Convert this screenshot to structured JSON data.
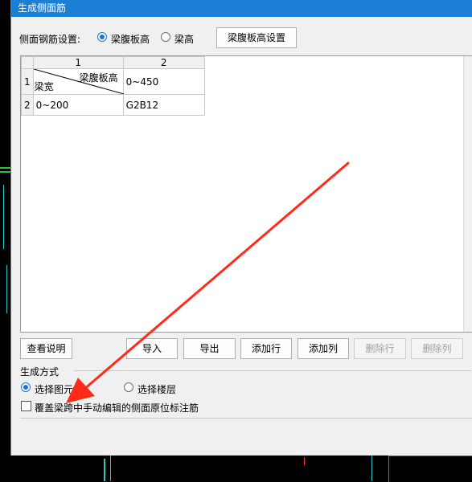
{
  "dialog": {
    "title": "生成侧面筋"
  },
  "settings": {
    "label": "侧面钢筋设置:",
    "options": [
      {
        "label": "梁腹板高",
        "checked": true
      },
      {
        "label": "梁高",
        "checked": false
      }
    ],
    "config_button": "梁腹板高设置"
  },
  "table": {
    "column_headers": [
      "1",
      "2"
    ],
    "row_headers": [
      "1",
      "2"
    ],
    "corner_top": "梁腹板高",
    "corner_bottom": "梁宽",
    "rows": [
      [
        "0~450"
      ],
      [
        "0~200",
        "G2B12"
      ]
    ]
  },
  "buttons": {
    "help": "查看说明",
    "import": "导入",
    "export": "导出",
    "add_row": "添加行",
    "add_col": "添加列",
    "del_row": "删除行",
    "del_col": "删除列"
  },
  "generate": {
    "title": "生成方式",
    "options": [
      {
        "label": "选择图元",
        "checked": true
      },
      {
        "label": "选择楼层",
        "checked": false
      }
    ],
    "overwrite_label": "覆盖梁跨中手动编辑的侧面原位标注筋",
    "overwrite_checked": false
  },
  "colors": {
    "accent": "#1a73d9",
    "titlebar": "#1b7fd6",
    "arrow": "#ff2a1a"
  }
}
